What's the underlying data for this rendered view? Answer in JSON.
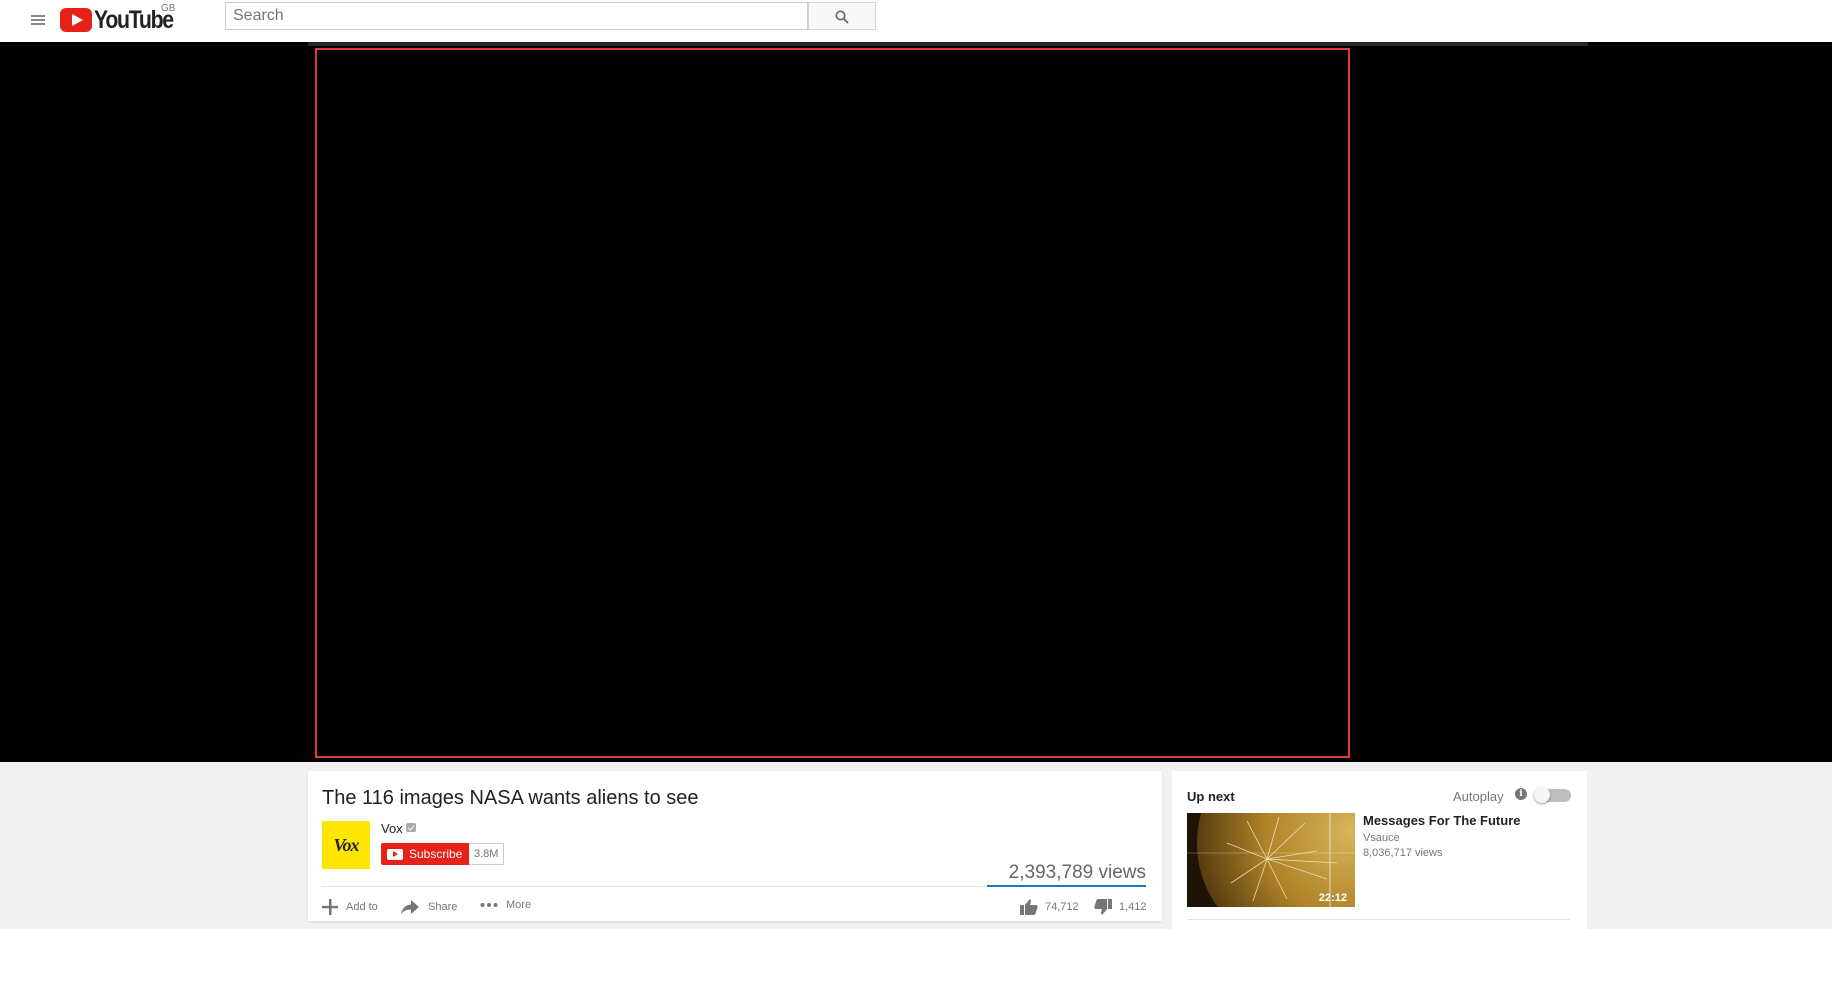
{
  "masthead": {
    "logo_text": "YouTube",
    "country_code": "GB",
    "search_placeholder": "Search",
    "icons": [
      "menu-icon",
      "search-icon"
    ]
  },
  "video": {
    "title": "The 116 images NASA wants aliens to see",
    "channel_name": "Vox",
    "channel_avatar_text": "Vox",
    "subscribe_label": "Subscribe",
    "subscriber_count": "3.8M",
    "views": "2,393,789 views",
    "like_ratio": 0.98,
    "actions": {
      "add_to": "Add to",
      "share": "Share",
      "more": "More"
    },
    "likes": "74,712",
    "dislikes": "1,412"
  },
  "up_next": {
    "label": "Up next",
    "autoplay_label": "Autoplay",
    "autoplay_on": false,
    "recommendation": {
      "title": "Messages For The Future",
      "channel": "Vsauce",
      "views": "8,036,717 views",
      "duration": "22:12"
    }
  },
  "colors": {
    "brand_red": "#e62117",
    "player_highlight": "#e0393e",
    "sentiment_blue": "#167ac6",
    "content_background": "#f1f1f1"
  }
}
